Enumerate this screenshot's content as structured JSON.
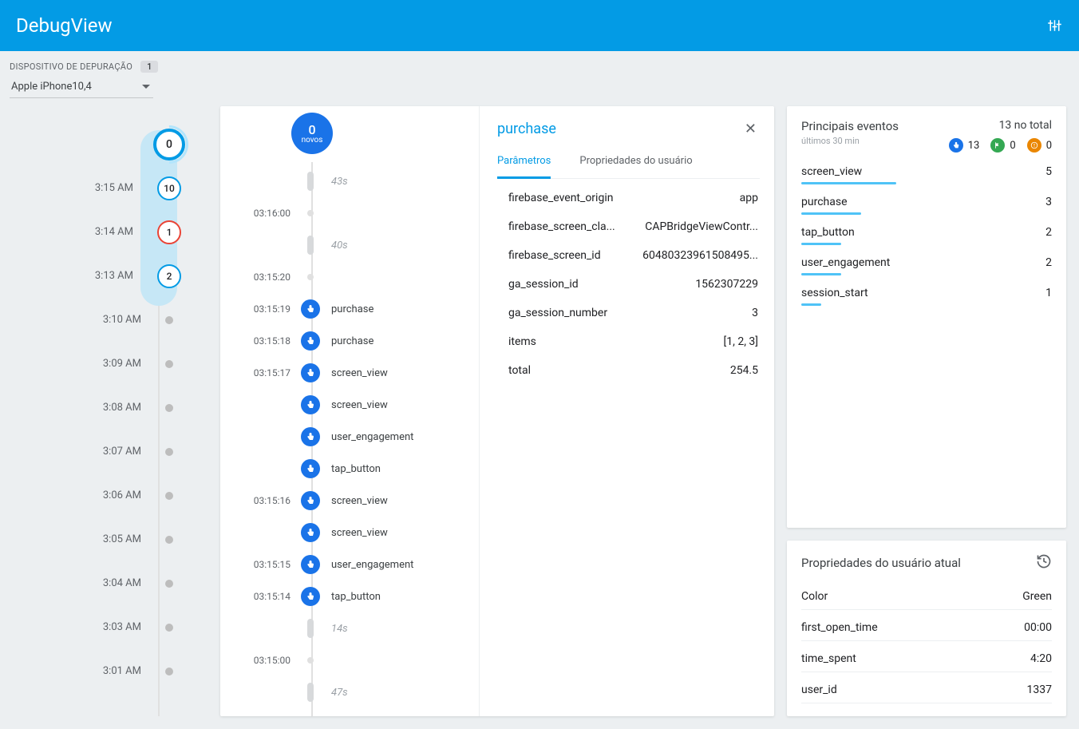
{
  "header": {
    "title": "DebugView"
  },
  "topbar": {
    "label": "DISPOSITIVO DE DEPURAÇÃO",
    "count": "1",
    "device": "Apple iPhone10,4"
  },
  "minutes": {
    "first": {
      "value": "0"
    },
    "bubbles": [
      {
        "time": "3:15 AM",
        "value": "10",
        "variant": "blue"
      },
      {
        "time": "3:14 AM",
        "value": "1",
        "variant": "red"
      },
      {
        "time": "3:13 AM",
        "value": "2",
        "variant": "blue"
      }
    ],
    "dots": [
      "3:10 AM",
      "3:09 AM",
      "3:08 AM",
      "3:07 AM",
      "3:06 AM",
      "3:05 AM",
      "3:04 AM",
      "3:03 AM",
      "3:01 AM"
    ]
  },
  "stream": {
    "big": {
      "value": "0",
      "sub": "novos"
    },
    "rows": [
      {
        "type": "gap",
        "time": "",
        "label": "43s"
      },
      {
        "type": "tick",
        "time": "03:16:00",
        "label": ""
      },
      {
        "type": "gap",
        "time": "",
        "label": "40s"
      },
      {
        "type": "tick",
        "time": "03:15:20",
        "label": ""
      },
      {
        "type": "event",
        "time": "03:15:19",
        "label": "purchase"
      },
      {
        "type": "event",
        "time": "03:15:18",
        "label": "purchase"
      },
      {
        "type": "event",
        "time": "03:15:17",
        "label": "screen_view"
      },
      {
        "type": "event",
        "time": "",
        "label": "screen_view"
      },
      {
        "type": "event",
        "time": "",
        "label": "user_engagement"
      },
      {
        "type": "event",
        "time": "",
        "label": "tap_button"
      },
      {
        "type": "event",
        "time": "03:15:16",
        "label": "screen_view"
      },
      {
        "type": "event",
        "time": "",
        "label": "screen_view"
      },
      {
        "type": "event",
        "time": "03:15:15",
        "label": "user_engagement"
      },
      {
        "type": "event",
        "time": "03:15:14",
        "label": "tap_button"
      },
      {
        "type": "gap",
        "time": "",
        "label": "14s"
      },
      {
        "type": "tick",
        "time": "03:15:00",
        "label": ""
      },
      {
        "type": "gap",
        "time": "",
        "label": "47s"
      }
    ]
  },
  "detail": {
    "title": "purchase",
    "tabs": {
      "params": "Parâmetros",
      "userprops": "Propriedades do usuário"
    },
    "params": [
      {
        "key": "firebase_event_origin",
        "val": "app"
      },
      {
        "key": "firebase_screen_cla...",
        "val": "CAPBridgeViewContr..."
      },
      {
        "key": "firebase_screen_id",
        "val": "60480323961508495..."
      },
      {
        "key": "ga_session_id",
        "val": "1562307229"
      },
      {
        "key": "ga_session_number",
        "val": "3"
      },
      {
        "key": "items",
        "val": "[1, 2, 3]"
      },
      {
        "key": "total",
        "val": "254.5"
      }
    ]
  },
  "topEvents": {
    "title": "Principais eventos",
    "sub": "últimos 30 min",
    "total_label": "13 no total",
    "badges": {
      "blue": "13",
      "green": "0",
      "orange": "0"
    },
    "list": [
      {
        "name": "screen_view",
        "count": "5",
        "bar": 38
      },
      {
        "name": "purchase",
        "count": "3",
        "bar": 24
      },
      {
        "name": "tap_button",
        "count": "2",
        "bar": 16
      },
      {
        "name": "user_engagement",
        "count": "2",
        "bar": 16
      },
      {
        "name": "session_start",
        "count": "1",
        "bar": 8
      }
    ]
  },
  "userProps": {
    "title": "Propriedades do usuário atual",
    "list": [
      {
        "key": "Color",
        "val": "Green"
      },
      {
        "key": "first_open_time",
        "val": "00:00"
      },
      {
        "key": "time_spent",
        "val": "4:20"
      },
      {
        "key": "user_id",
        "val": "1337"
      }
    ]
  }
}
